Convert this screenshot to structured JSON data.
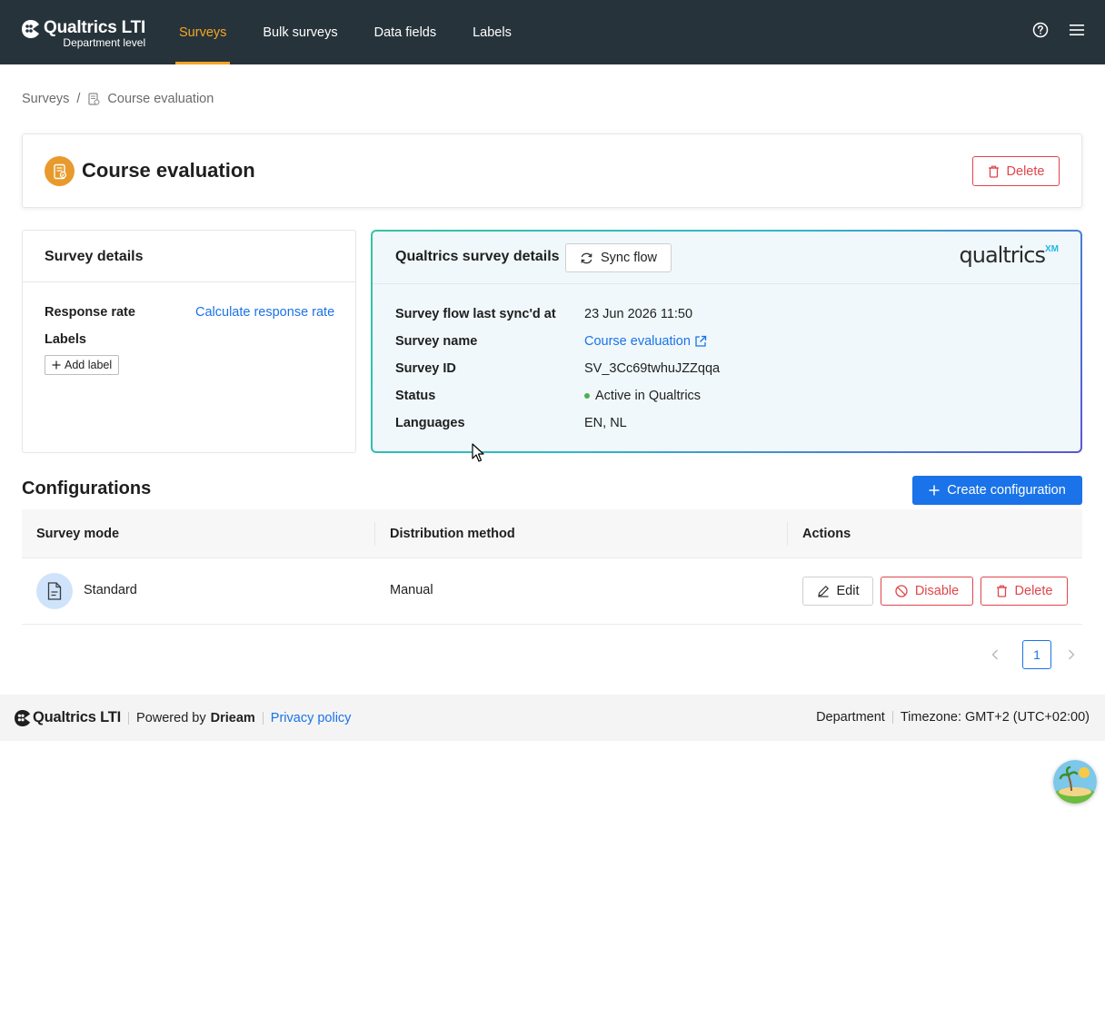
{
  "app": {
    "brand_title": "Qualtrics LTI",
    "brand_subtitle": "Department level"
  },
  "nav": {
    "items": [
      {
        "label": "Surveys",
        "active": true
      },
      {
        "label": "Bulk surveys"
      },
      {
        "label": "Data fields"
      },
      {
        "label": "Labels"
      }
    ]
  },
  "header_icons": [
    "help-icon",
    "menu-icon"
  ],
  "breadcrumb": {
    "root": "Surveys",
    "separator": "/",
    "current": "Course evaluation"
  },
  "page": {
    "title": "Course evaluation",
    "delete_label": "Delete"
  },
  "survey_details": {
    "heading": "Survey details",
    "response_rate_label": "Response rate",
    "response_rate_link": "Calculate response rate",
    "labels_label": "Labels",
    "add_label": "Add label"
  },
  "qualtrics_details": {
    "heading": "Qualtrics survey details",
    "sync_label": "Sync flow",
    "logo_text": "qualtrics",
    "logo_sup": "XM",
    "rows": [
      {
        "key": "Survey flow last sync'd at",
        "value": "23 Jun 2026 11:50"
      },
      {
        "key": "Survey name",
        "value": "Course evaluation"
      },
      {
        "key": "Survey ID",
        "value": "SV_3Cc69twhuJZZqqa"
      },
      {
        "key": "Status",
        "value": "Active in Qualtrics"
      },
      {
        "key": "Languages",
        "value": "EN, NL"
      }
    ],
    "status_color": "#4caf50"
  },
  "configurations": {
    "title": "Configurations",
    "create_label": "Create configuration",
    "columns": [
      "Survey mode",
      "Distribution method",
      "Actions"
    ],
    "rows": [
      {
        "mode": "Standard",
        "distribution": "Manual",
        "edit": "Edit",
        "disable": "Disable",
        "delete": "Delete"
      }
    ]
  },
  "pagination": {
    "current": "1"
  },
  "footer": {
    "brand": "Qualtrics LTI",
    "powered_prefix": "Powered by",
    "powered_by": "Drieam",
    "privacy": "Privacy policy",
    "department": "Department",
    "timezone": "Timezone: GMT+2 (UTC+02:00)"
  },
  "colors": {
    "topbar": "#27333b",
    "accent": "#f5a623",
    "primary": "#1a73e8",
    "danger": "#e0454a"
  }
}
